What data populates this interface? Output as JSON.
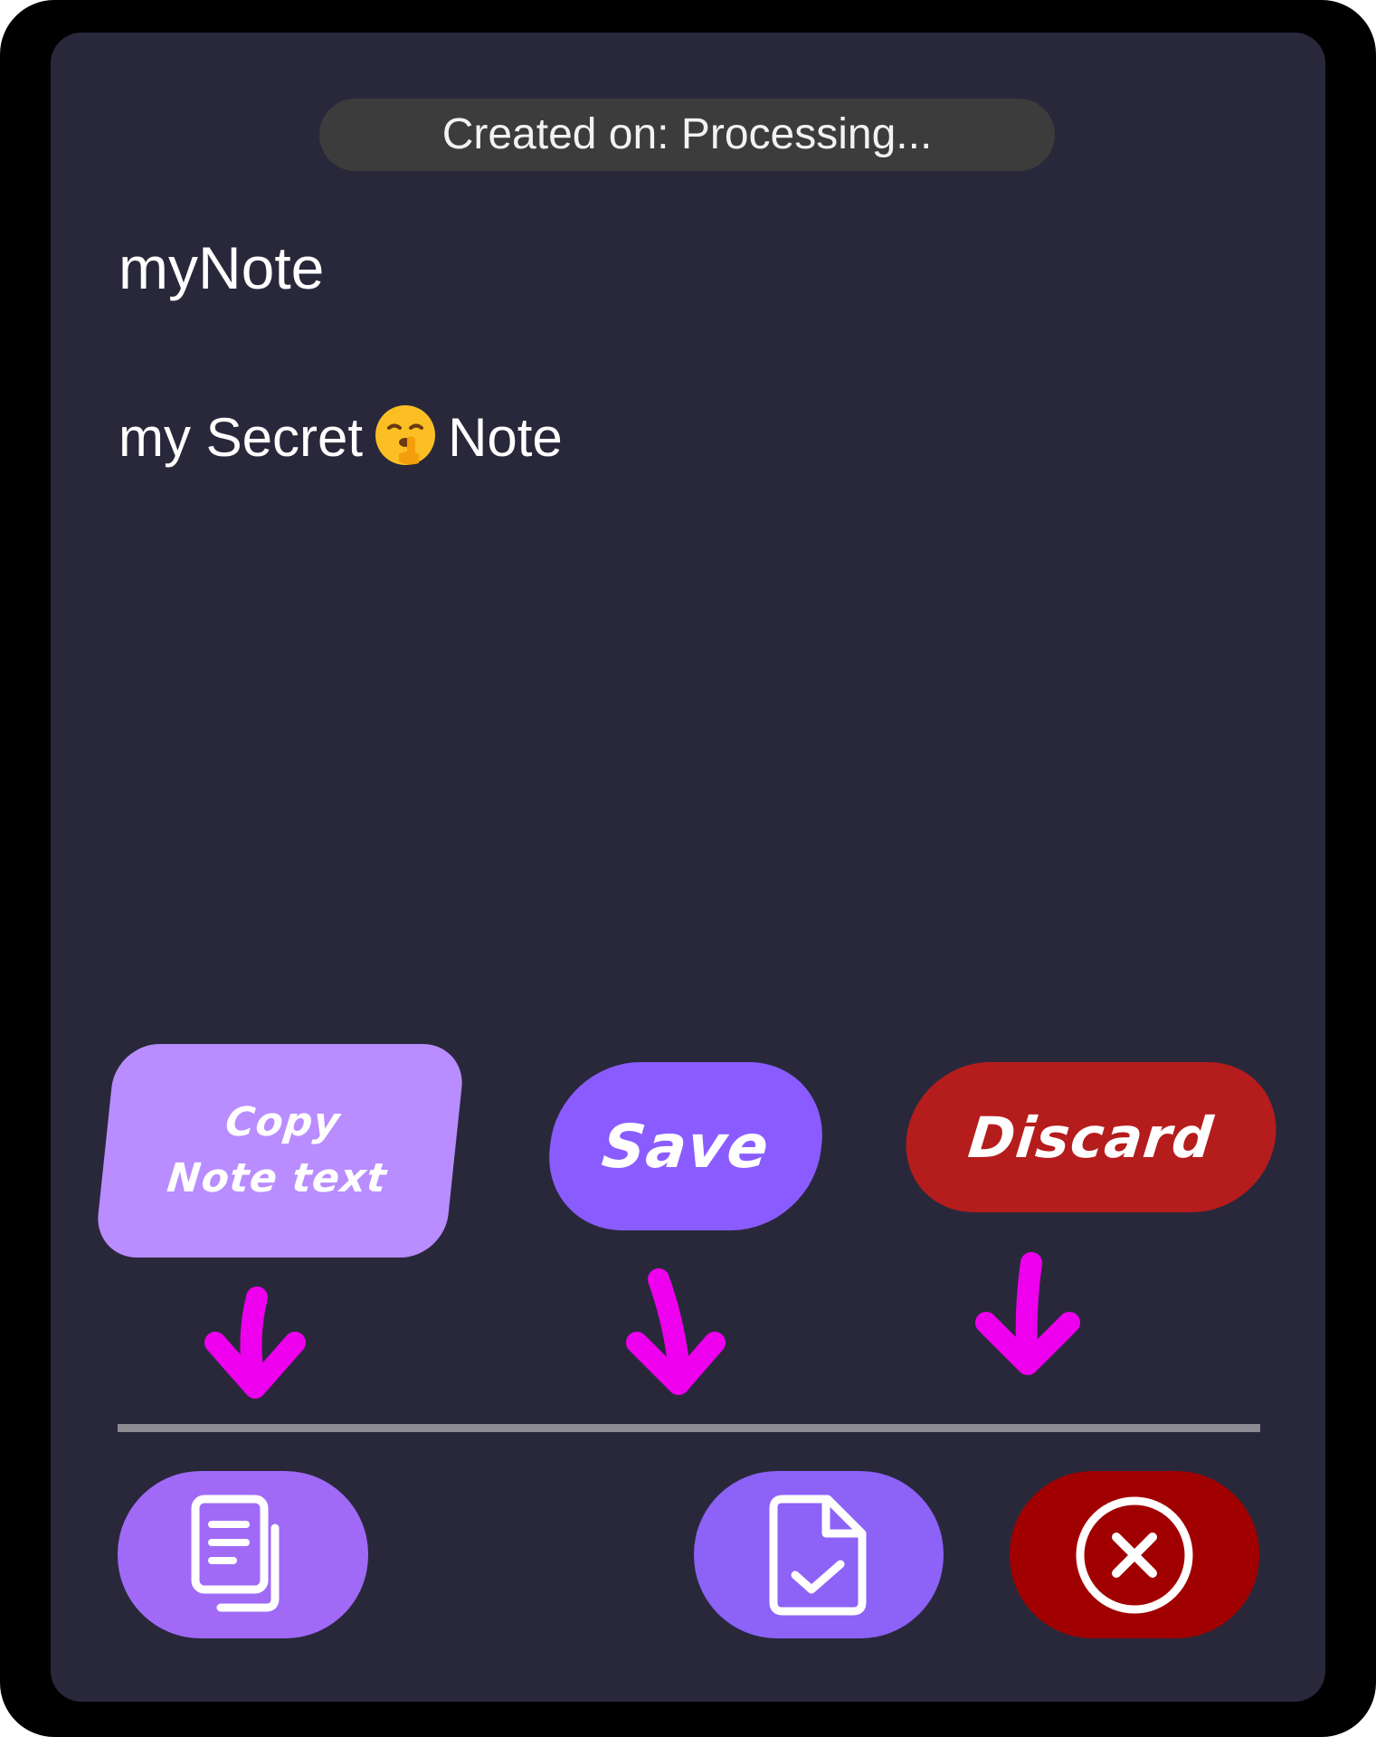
{
  "note": {
    "created_label": "Created on: Processing...",
    "title": "myNote",
    "body_before_emoji": "my Secret",
    "body_emoji": "shushing-face-emoji",
    "body_after_emoji": "Note"
  },
  "callouts": {
    "copy": "Copy\nNote text",
    "save": "Save",
    "discard": "Discard"
  },
  "actions": {
    "copy": {
      "icon": "copy-document-icon",
      "color": "#a06af7"
    },
    "save": {
      "icon": "file-check-icon",
      "color": "#8c62f7"
    },
    "discard": {
      "icon": "close-circle-icon",
      "color": "#a10000"
    }
  },
  "colors": {
    "background": "#29283b",
    "annotation_arrow": "#ee00ee",
    "copy_callout": "#b98cff",
    "save_callout": "#8a5cff",
    "discard_callout": "#b51c1c"
  }
}
